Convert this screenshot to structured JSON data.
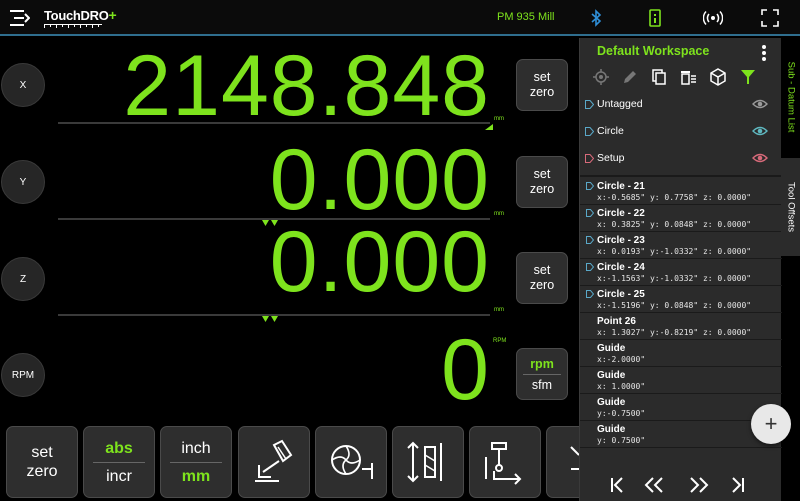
{
  "app": {
    "logo_text": "TouchDRO",
    "logo_plus": "+",
    "machine_name": "PM 935 Mill"
  },
  "axes": [
    {
      "label": "X",
      "value": "2148.848",
      "unit": "mm",
      "zero_label_1": "set",
      "zero_label_2": "zero"
    },
    {
      "label": "Y",
      "value": "0.000",
      "unit": "mm",
      "zero_label_1": "set",
      "zero_label_2": "zero"
    },
    {
      "label": "Z",
      "value": "0.000",
      "unit": "mm",
      "zero_label_1": "set",
      "zero_label_2": "zero"
    }
  ],
  "spindle": {
    "label": "RPM",
    "value": "0",
    "unit": "RPM",
    "mode_active": "rpm",
    "mode_alt": "sfm"
  },
  "toolbar": {
    "set_zero_1": "set",
    "set_zero_2": "zero",
    "abs": "abs",
    "incr": "incr",
    "inch": "inch",
    "mm": "mm"
  },
  "panel": {
    "title": "Default Workspace",
    "folders": [
      {
        "label": "Untagged",
        "tag_color": "#5aa8c8",
        "eye_color": "#9a9a9a"
      },
      {
        "label": "Circle",
        "tag_color": "#5aa8c8",
        "eye_color": "#5fb8c0"
      },
      {
        "label": "Setup",
        "tag_color": "#d86a7a",
        "eye_color": "#d86a7a"
      }
    ],
    "points": [
      {
        "name": "Circle - 21",
        "coords": "x:-0.5685\" y: 0.7758\" z: 0.0000\"",
        "tag": true
      },
      {
        "name": "Circle - 22",
        "coords": "x: 0.3825\" y: 0.0848\" z: 0.0000\"",
        "tag": true
      },
      {
        "name": "Circle - 23",
        "coords": "x: 0.0193\" y:-1.0332\" z: 0.0000\"",
        "tag": true
      },
      {
        "name": "Circle - 24",
        "coords": "x:-1.1563\" y:-1.0332\" z: 0.0000\"",
        "tag": true
      },
      {
        "name": "Circle - 25",
        "coords": "x:-1.5196\" y: 0.0848\" z: 0.0000\"",
        "tag": true
      },
      {
        "name": "Point 26",
        "coords": "x: 1.3027\" y:-0.8219\" z: 0.0000\"",
        "tag": false
      },
      {
        "name": "Guide",
        "coords": "x:-2.0000\"",
        "tag": false
      },
      {
        "name": "Guide",
        "coords": "x: 1.0000\"",
        "tag": false
      },
      {
        "name": "Guide",
        "coords": "y:-0.7500\"",
        "tag": false
      },
      {
        "name": "Guide",
        "coords": "y: 0.7500\"",
        "tag": false
      }
    ],
    "fab_label": "+"
  },
  "side_tabs": {
    "datum": "Sub - Datum List",
    "tools": "Tool Offsets"
  },
  "colors": {
    "accent": "#7ee31d",
    "panel_bg": "#2b2b2b",
    "bar_line": "#2f6e8e"
  },
  "icons": [
    "menu-icon",
    "bluetooth-icon",
    "calculator-icon",
    "wireless-icon",
    "fullscreen-icon",
    "target-icon",
    "pencil-icon",
    "copy-icon",
    "delete-icon",
    "cube-icon",
    "filter-icon",
    "eye-icon",
    "plus-icon",
    "first-icon",
    "prev-icon",
    "next-icon",
    "last-icon"
  ]
}
